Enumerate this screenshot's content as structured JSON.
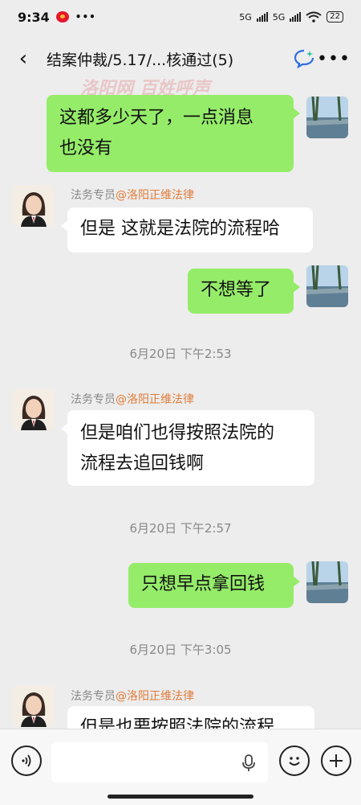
{
  "status": {
    "time": "9:34",
    "net1": "5G",
    "net2": "5G",
    "battery": "22"
  },
  "header": {
    "title": "结案仲裁/5.17/...核通过(5)"
  },
  "messages": [
    {
      "text_lines": [
        "这都多少天了，一点消息",
        "也没有"
      ]
    },
    {
      "sender_role": "法务专员",
      "sender_org": "@洛阳正维法律",
      "text_lines": [
        "但是 这就是法院的流程哈"
      ]
    },
    {
      "text_lines": [
        "不想等了"
      ]
    },
    {
      "time": "6月20日 下午2:53"
    },
    {
      "sender_role": "法务专员",
      "sender_org": "@洛阳正维法律",
      "text_lines": [
        "但是咱们也得按照法院的",
        "流程去追回钱啊"
      ]
    },
    {
      "time": "6月20日 下午2:57"
    },
    {
      "text_lines": [
        "只想早点拿回钱"
      ]
    },
    {
      "time": "6月20日 下午3:05"
    },
    {
      "sender_role": "法务专员",
      "sender_org": "@洛阳正维法律",
      "text_lines": [
        "但是也要按照法院的流程"
      ]
    }
  ],
  "watermark": {
    "text1": "洛阳网",
    "text2": "百姓呼声"
  }
}
